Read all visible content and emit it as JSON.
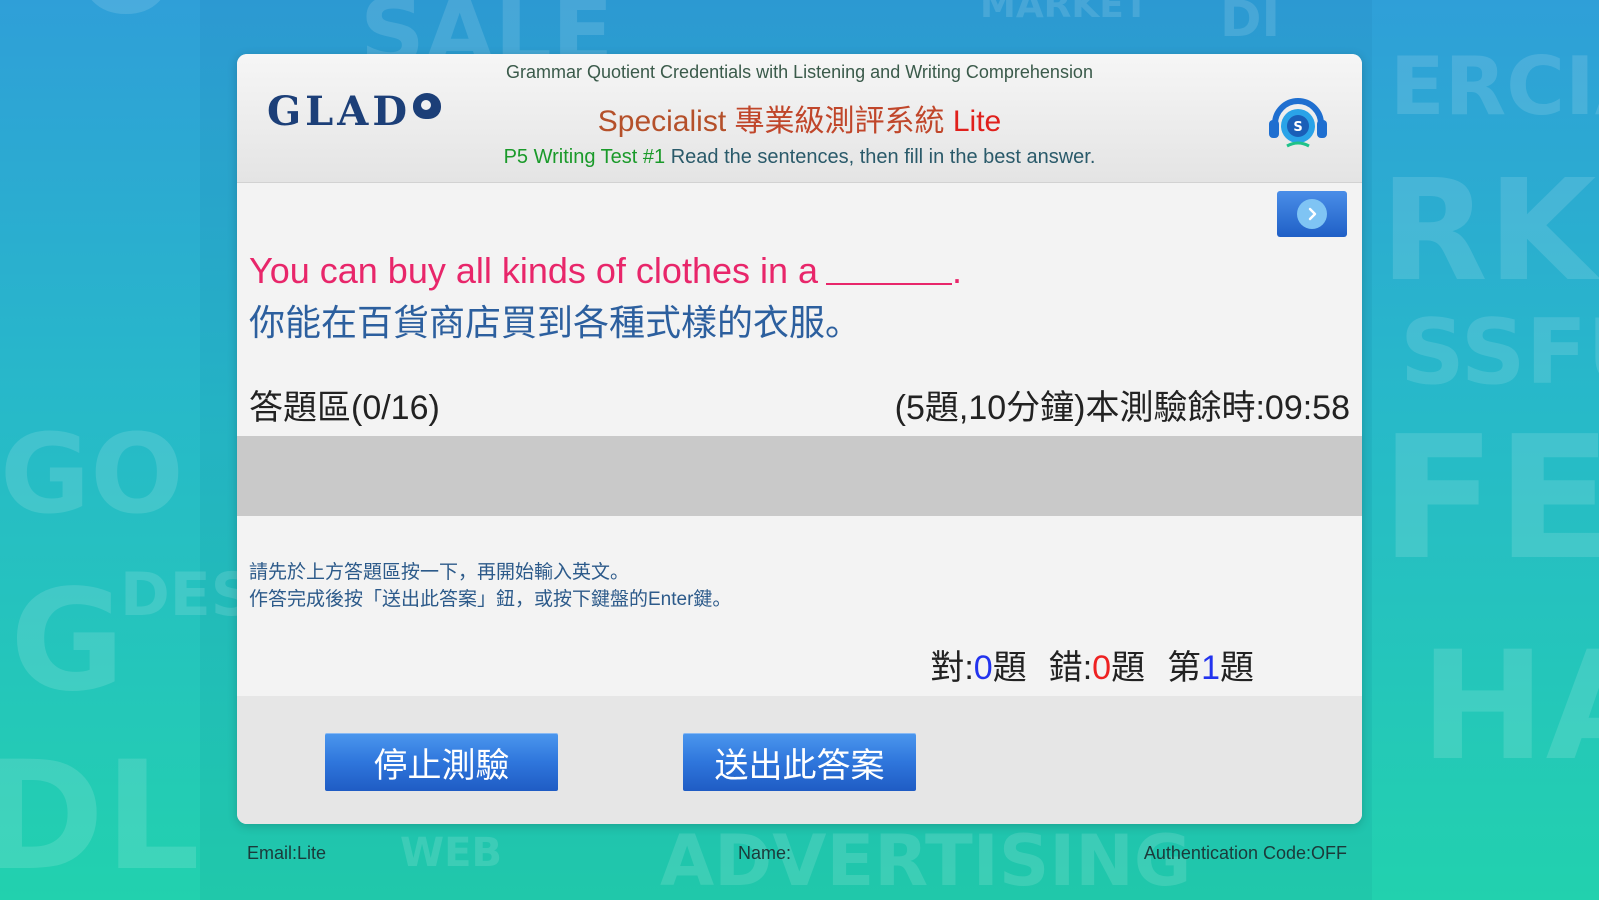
{
  "header": {
    "subtitle": "Grammar Quotient Credentials with Listening and Writing Comprehension",
    "logo_text": "GLAD",
    "title_specialist": "Specialist ",
    "title_cn": "專業級測評系統 ",
    "title_lite": "Lite",
    "test_name": "P5 Writing Test #1 ",
    "instruction": "Read the sentences, then fill in the best answer."
  },
  "question": {
    "english": "You can buy all kinds of clothes in a",
    "english_end": ".",
    "chinese": "你能在百貨商店買到各種式樣的衣服。"
  },
  "answer": {
    "label": "答題區(0/16)",
    "value": "",
    "timer": "(5題,10分鐘)本測驗餘時:09:58"
  },
  "hint": {
    "line1": "請先於上方答題區按一下，再開始輸入英文。",
    "line2": "作答完成後按「送出此答案」鈕，或按下鍵盤的Enter鍵。"
  },
  "score": {
    "correct_label": "對:",
    "correct_value": "0",
    "correct_unit": "題",
    "wrong_label": "錯:",
    "wrong_value": "0",
    "wrong_unit": "題",
    "question_label": "第",
    "question_value": "1",
    "question_unit": "題"
  },
  "buttons": {
    "stop": "停止測驗",
    "submit": "送出此答案"
  },
  "footer": {
    "email": "Email:Lite",
    "name": "Name:",
    "auth": "Authentication Code:OFF"
  },
  "colors": {
    "accent_blue": "#2f76dc",
    "question_pink": "#e8266a",
    "chinese_blue": "#2c5f9e",
    "title_lite_red": "#e0201c",
    "test_green": "#1a9a2a"
  },
  "icons": {
    "audio": "headphones-icon",
    "next": "chevron-right-icon"
  }
}
